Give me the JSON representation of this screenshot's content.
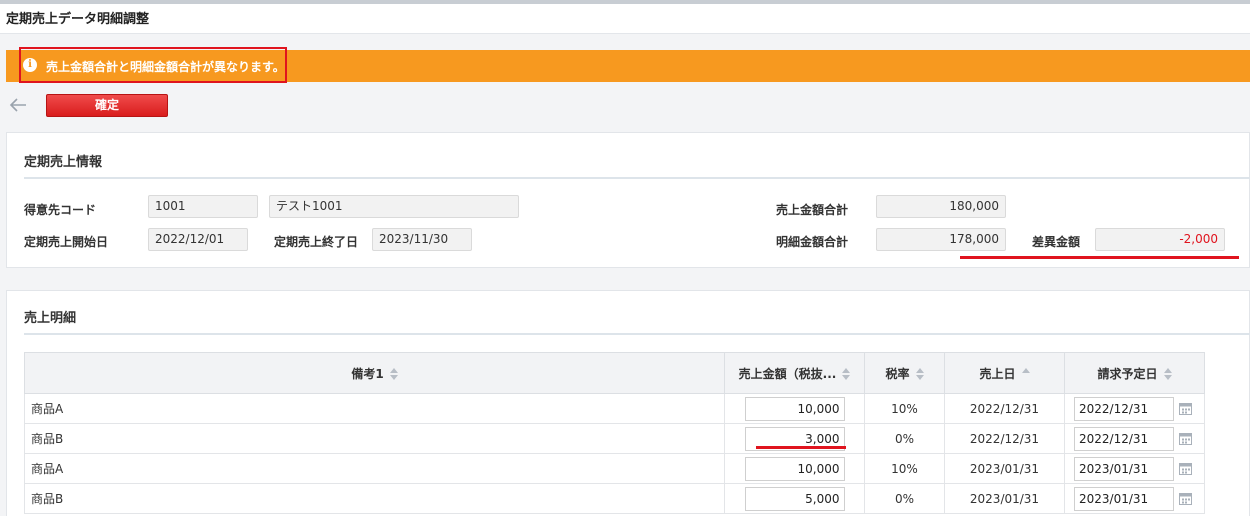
{
  "page": {
    "title": "定期売上データ明細調整"
  },
  "alert": {
    "icon": "info-icon",
    "message": "売上金額合計と明細金額合計が異なります。"
  },
  "toolbar": {
    "confirm_label": "確定"
  },
  "info": {
    "section_title": "定期売上情報",
    "customer_code_label": "得意先コード",
    "customer_code": "1001",
    "customer_name": "テスト1001",
    "start_date_label": "定期売上開始日",
    "start_date": "2022/12/01",
    "end_date_label": "定期売上終了日",
    "end_date": "2023/11/30",
    "sales_total_label": "売上金額合計",
    "sales_total": "180,000",
    "detail_total_label": "明細金額合計",
    "detail_total": "178,000",
    "difference_label": "差異金額",
    "difference": "-2,000"
  },
  "details": {
    "section_title": "売上明細",
    "columns": [
      "備考1",
      "売上金額（税抜...",
      "税率",
      "売上日",
      "請求予定日"
    ],
    "rows": [
      {
        "note": "商品A",
        "amount": "10,000",
        "tax": "10%",
        "sales_date": "2022/12/31",
        "billing_date": "2022/12/31"
      },
      {
        "note": "商品B",
        "amount": "3,000",
        "tax": "0%",
        "sales_date": "2022/12/31",
        "billing_date": "2022/12/31"
      },
      {
        "note": "商品A",
        "amount": "10,000",
        "tax": "10%",
        "sales_date": "2023/01/31",
        "billing_date": "2023/01/31"
      },
      {
        "note": "商品B",
        "amount": "5,000",
        "tax": "0%",
        "sales_date": "2023/01/31",
        "billing_date": "2023/01/31"
      }
    ]
  },
  "colors": {
    "alert": "#f7991f",
    "confirm": "#e02424",
    "highlight": "#e0141e"
  }
}
